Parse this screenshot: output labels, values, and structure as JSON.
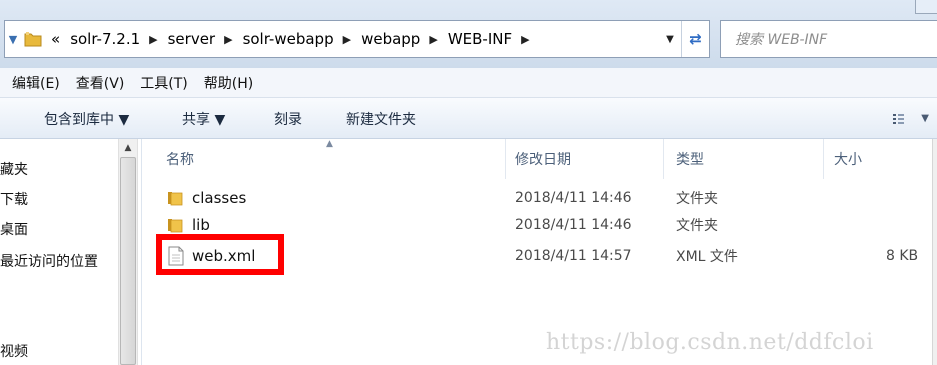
{
  "address_bar": {
    "breadcrumbs": [
      "«",
      "solr-7.2.1",
      "server",
      "solr-webapp",
      "webapp",
      "WEB-INF"
    ],
    "dropdown_icon": "chevron-down-icon",
    "refresh_icon": "refresh-icon"
  },
  "search": {
    "placeholder": "搜索 WEB-INF"
  },
  "menu": [
    "编辑(E)",
    "查看(V)",
    "工具(T)",
    "帮助(H)"
  ],
  "toolbar": {
    "include_library": "包含到库中 ▼",
    "share": "共享 ▼",
    "burn": "刻录",
    "new_folder": "新建文件夹",
    "view_icon": "view-options-icon"
  },
  "nav": [
    "藏夹",
    "下载",
    "桌面",
    "最近访问的位置",
    "视频"
  ],
  "columns": {
    "name": "名称",
    "modified": "修改日期",
    "type": "类型",
    "size": "大小"
  },
  "files": [
    {
      "name": "classes",
      "modified": "2018/4/11 14:46",
      "type": "文件夹",
      "size": "",
      "icon": "folder-icon"
    },
    {
      "name": "lib",
      "modified": "2018/4/11 14:46",
      "type": "文件夹",
      "size": "",
      "icon": "folder-icon"
    },
    {
      "name": "web.xml",
      "modified": "2018/4/11 14:57",
      "type": "XML 文件",
      "size": "8 KB",
      "icon": "xml-file-icon"
    }
  ],
  "watermark": "https://blog.csdn.net/ddfcloi",
  "colors": {
    "highlight": "#ff0000",
    "folder": "#e8b93c"
  }
}
